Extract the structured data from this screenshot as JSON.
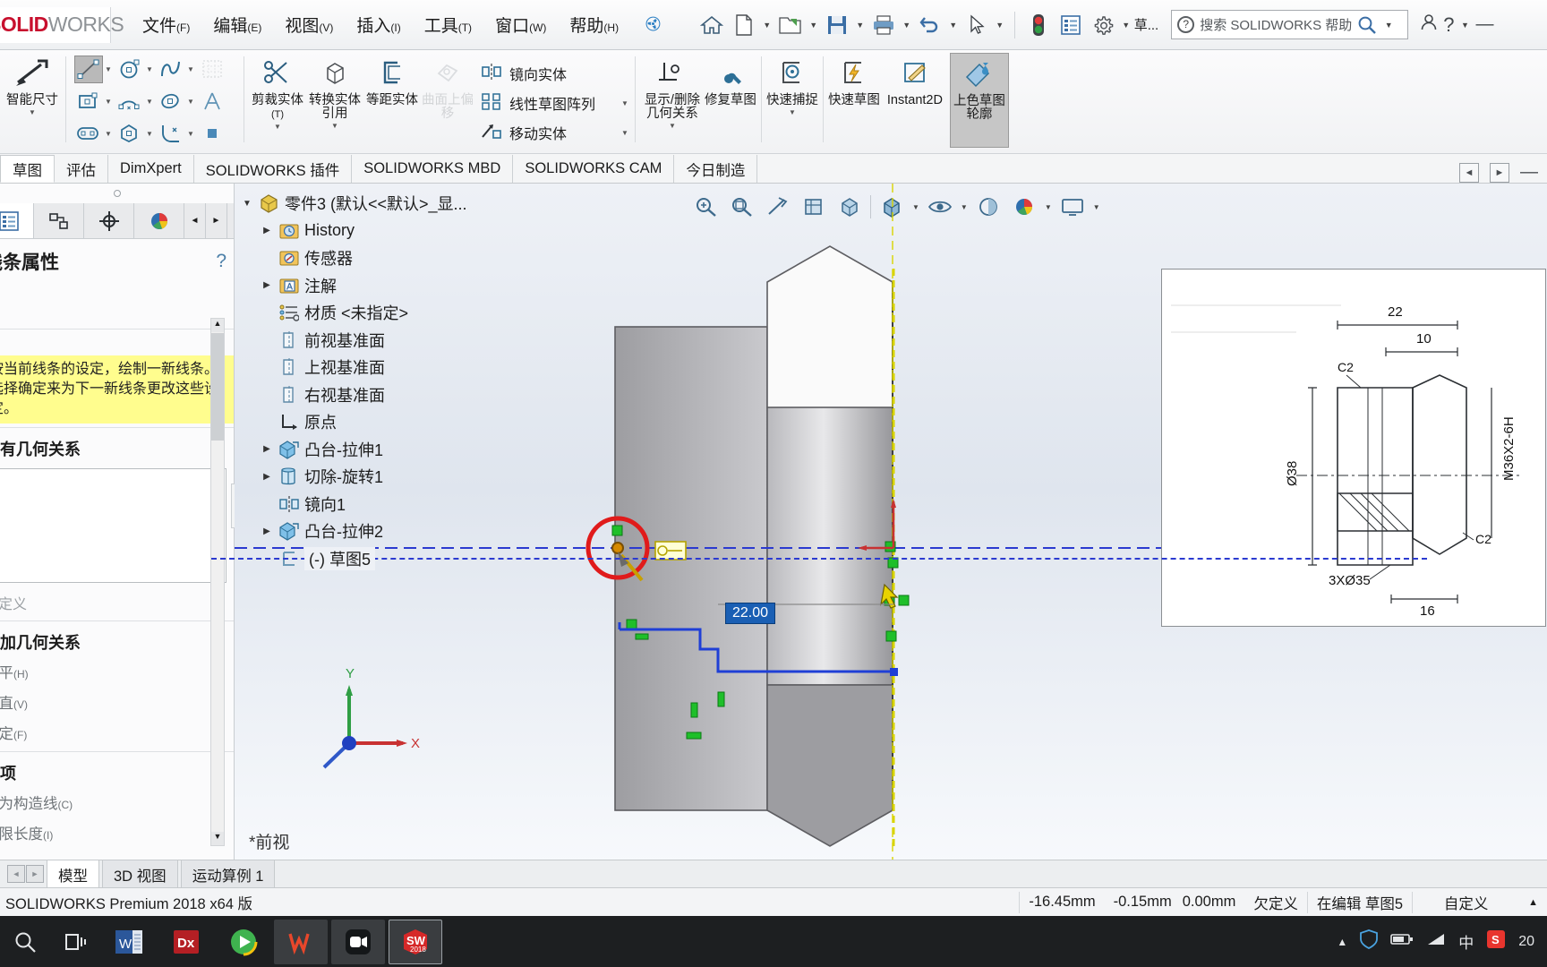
{
  "app": {
    "brand_solid": "SOLID",
    "brand_works": "WORKS",
    "version_text": "SOLIDWORKS Premium 2018 x64 版"
  },
  "menubar": {
    "items": [
      {
        "label": "文件",
        "accel": "(F)"
      },
      {
        "label": "编辑",
        "accel": "(E)"
      },
      {
        "label": "视图",
        "accel": "(V)"
      },
      {
        "label": "插入",
        "accel": "(I)"
      },
      {
        "label": "工具",
        "accel": "(T)"
      },
      {
        "label": "窗口",
        "accel": "(W)"
      },
      {
        "label": "帮助",
        "accel": "(H)"
      }
    ],
    "pin_icon": "pin-icon",
    "quick_tools": [
      {
        "name": "home-icon",
        "glyph": "⌂"
      },
      {
        "name": "new-document-icon",
        "glyph": "🗋"
      },
      {
        "name": "open-folder-icon",
        "glyph": "📂"
      },
      {
        "name": "save-icon",
        "glyph": "💾"
      },
      {
        "name": "print-icon",
        "glyph": "🖨"
      },
      {
        "name": "undo-icon",
        "glyph": "↶"
      },
      {
        "name": "select-arrow-icon",
        "glyph": "➤"
      },
      {
        "name": "rebuild-traffic-icon",
        "glyph": "🚦"
      },
      {
        "name": "options-list-icon",
        "glyph": "▤"
      },
      {
        "name": "settings-gear-icon",
        "glyph": "⚙"
      }
    ],
    "tab_label": "草...",
    "search_placeholder": "搜索 SOLIDWORKS 帮助",
    "right_icons": [
      {
        "name": "user-account-icon",
        "glyph": "👤"
      },
      {
        "name": "help-question-icon",
        "glyph": "?"
      },
      {
        "name": "minimize-icon",
        "glyph": "—"
      }
    ]
  },
  "ribbon": {
    "smart_dimension": {
      "label": "智能尺寸",
      "icon": "smart-dimension-icon"
    },
    "sketch_tools": [
      {
        "name": "line-tool",
        "glyph": "╱",
        "selected": true,
        "caret": true
      },
      {
        "name": "circle-tool",
        "glyph": "◎",
        "selected": false,
        "caret": true
      },
      {
        "name": "spline-tool",
        "glyph": "∿",
        "selected": false,
        "caret": true
      },
      {
        "name": "grid-tool",
        "glyph": "▦",
        "selected": false,
        "caret": false
      },
      {
        "name": "rectangle-tool",
        "glyph": "▭",
        "selected": false,
        "caret": true
      },
      {
        "name": "arc-tool",
        "glyph": "◠",
        "selected": false,
        "caret": true
      },
      {
        "name": "ellipse-tool",
        "glyph": "⬭",
        "selected": false,
        "caret": true
      },
      {
        "name": "text-tool",
        "glyph": "A",
        "selected": false,
        "caret": false
      },
      {
        "name": "slot-tool",
        "glyph": "▱",
        "selected": false,
        "caret": true
      },
      {
        "name": "polygon-tool",
        "glyph": "⬡",
        "selected": false,
        "caret": true
      },
      {
        "name": "fillet-tool",
        "glyph": "◜",
        "selected": false,
        "caret": true
      },
      {
        "name": "point-tool",
        "glyph": "▪",
        "selected": false,
        "caret": false
      }
    ],
    "big_buttons": [
      {
        "name": "trim-entities-button",
        "label": "剪裁实体",
        "accel": "(T)",
        "icon": "trim-icon",
        "caret": true,
        "disabled": false,
        "selected": false
      },
      {
        "name": "convert-entities-button",
        "label": "转换实体引用",
        "accel": "",
        "icon": "convert-entities-icon",
        "caret": true,
        "disabled": false,
        "selected": false
      },
      {
        "name": "offset-entities-button",
        "label": "等距实体",
        "accel": "",
        "icon": "offset-entities-icon",
        "caret": false,
        "disabled": false,
        "selected": false
      },
      {
        "name": "offset-on-surface-button",
        "label": "曲面上偏移",
        "accel": "",
        "icon": "offset-surface-icon",
        "caret": false,
        "disabled": true,
        "selected": false
      }
    ],
    "list_items": [
      {
        "name": "mirror-entities-item",
        "label": "镜向实体",
        "icon": "mirror-icon",
        "caret": false
      },
      {
        "name": "linear-sketch-pattern-item",
        "label": "线性草图阵列",
        "icon": "linear-pattern-icon",
        "caret": true
      },
      {
        "name": "move-entities-item",
        "label": "移动实体",
        "icon": "move-entities-icon",
        "caret": true
      }
    ],
    "big_buttons2": [
      {
        "name": "display-delete-relations-button",
        "label": "显示/删除几何关系",
        "accel": "",
        "icon": "relations-icon",
        "caret": true,
        "disabled": false,
        "selected": false
      },
      {
        "name": "repair-sketch-button",
        "label": "修复草图",
        "accel": "",
        "icon": "repair-sketch-icon",
        "caret": false,
        "disabled": false,
        "selected": false
      },
      {
        "name": "quick-snaps-button",
        "label": "快速捕捉",
        "accel": "",
        "icon": "quick-snaps-icon",
        "caret": true,
        "disabled": false,
        "selected": false
      },
      {
        "name": "rapid-sketch-button",
        "label": "快速草图",
        "accel": "",
        "icon": "rapid-sketch-icon",
        "caret": false,
        "disabled": false,
        "selected": false
      },
      {
        "name": "instant2d-button",
        "label": "Instant2D",
        "accel": "",
        "icon": "instant2d-icon",
        "caret": false,
        "disabled": false,
        "selected": false
      },
      {
        "name": "shaded-sketch-contours-button",
        "label": "上色草图轮廓",
        "accel": "",
        "icon": "shaded-contours-icon",
        "caret": false,
        "disabled": false,
        "selected": true
      }
    ]
  },
  "tabs": {
    "items": [
      {
        "label": "草图",
        "active": true
      },
      {
        "label": "评估",
        "active": false
      },
      {
        "label": "DimXpert",
        "active": false
      },
      {
        "label": "SOLIDWORKS 插件",
        "active": false
      },
      {
        "label": "SOLIDWORKS MBD",
        "active": false
      },
      {
        "label": "SOLIDWORKS CAM",
        "active": false
      },
      {
        "label": "今日制造",
        "active": false
      }
    ],
    "right_buttons": [
      {
        "name": "panel-collapse-left-button",
        "glyph": "◄"
      },
      {
        "name": "panel-collapse-right-button",
        "glyph": "►"
      },
      {
        "name": "window-minimize-button",
        "glyph": "—"
      }
    ]
  },
  "property_panel": {
    "tabs": [
      {
        "name": "feature-manager-tab",
        "glyph": "▤",
        "active": true
      },
      {
        "name": "property-manager-tab",
        "glyph": "⚵",
        "active": false
      },
      {
        "name": "configuration-manager-tab",
        "glyph": "⊕",
        "active": false
      },
      {
        "name": "display-manager-tab",
        "glyph": "◕",
        "active": false
      }
    ],
    "nav_prev": "◄",
    "nav_next": "►",
    "title": "线条属性",
    "help_icon": "help-circle-icon",
    "hint_text": "按当前线条的设定，绘制一新线条。选择确定来为下一新线条更改这些设定。",
    "existing_relations": {
      "title": "现有几何关系",
      "chevron": "⌃"
    },
    "underdefined_label": "欠定义",
    "add_relations": {
      "title": "添加几何关系",
      "chevron": "⌃",
      "items": [
        {
          "label": "水平",
          "accel": "(H)"
        },
        {
          "label": "竖直",
          "accel": "(V)"
        },
        {
          "label": "固定",
          "accel": "(F)"
        }
      ]
    },
    "options": {
      "title": "选项",
      "chevron": "⌃",
      "items": [
        {
          "label": "作为构造线",
          "accel": "(C)"
        },
        {
          "label": "无限长度",
          "accel": "(I)"
        }
      ]
    }
  },
  "tree": {
    "root": {
      "label": "零件3   (默认<<默认>_显...",
      "icon": "part-icon",
      "arrow": "▼"
    },
    "items": [
      {
        "label": "History",
        "icon": "history-icon",
        "arrow": "▶",
        "indent": 1
      },
      {
        "label": "传感器",
        "icon": "sensors-icon",
        "arrow": "",
        "indent": 1
      },
      {
        "label": "注解",
        "icon": "annotations-icon",
        "arrow": "▶",
        "indent": 1
      },
      {
        "label": "材质 <未指定>",
        "icon": "material-icon",
        "arrow": "",
        "indent": 1
      },
      {
        "label": "前视基准面",
        "icon": "plane-icon",
        "arrow": "",
        "indent": 1
      },
      {
        "label": "上视基准面",
        "icon": "plane-icon",
        "arrow": "",
        "indent": 1
      },
      {
        "label": "右视基准面",
        "icon": "plane-icon",
        "arrow": "",
        "indent": 1
      },
      {
        "label": "原点",
        "icon": "origin-icon",
        "arrow": "",
        "indent": 1
      },
      {
        "label": "凸台-拉伸1",
        "icon": "boss-extrude-icon",
        "arrow": "▶",
        "indent": 1
      },
      {
        "label": "切除-旋转1",
        "icon": "cut-revolve-icon",
        "arrow": "▶",
        "indent": 1
      },
      {
        "label": "镜向1",
        "icon": "mirror-feature-icon",
        "arrow": "",
        "indent": 1
      },
      {
        "label": "凸台-拉伸2",
        "icon": "boss-extrude-icon",
        "arrow": "▶",
        "indent": 1
      },
      {
        "label": "(-) 草图5",
        "icon": "sketch-icon",
        "arrow": "",
        "indent": 1,
        "editing": true
      }
    ]
  },
  "graphics": {
    "view_tools": [
      {
        "name": "zoom-to-fit-icon",
        "glyph": "⌕"
      },
      {
        "name": "zoom-to-area-icon",
        "glyph": "⌕"
      },
      {
        "name": "section-view-icon",
        "glyph": "✂"
      },
      {
        "name": "view-orientation-icon",
        "glyph": "▣"
      },
      {
        "name": "display-style-icon",
        "glyph": "◪"
      },
      {
        "name": "hide-show-items-icon",
        "glyph": "▥"
      },
      {
        "name": "view-cube-icon",
        "glyph": "⬛",
        "caret": true
      },
      {
        "name": "hide-show-eye-icon",
        "glyph": "👁",
        "caret": true
      },
      {
        "name": "apply-scene-icon",
        "glyph": "◐"
      },
      {
        "name": "appearance-sphere-icon",
        "glyph": "🎨",
        "caret": true
      },
      {
        "name": "view-settings-icon",
        "glyph": "🖵",
        "caret": true
      }
    ],
    "dimension_value": "22.00",
    "view_label": "*前视",
    "origin_x_label": "X",
    "origin_y_label": "Y"
  },
  "reference_drawing": {
    "dims": [
      "22",
      "10",
      "C2",
      "Ø38",
      "M36X2-6H",
      "3XØ35",
      "C2",
      "16"
    ]
  },
  "ime_bar": {
    "brand": "S",
    "mode": "中",
    "punct": "°,",
    "emoji_icon": "smiley-icon",
    "mic_icon": "microphone-icon",
    "keyboard_icon": "keyboard-icon"
  },
  "doc_tabs": {
    "nav_prev": "◄",
    "nav_next": "►",
    "items": [
      {
        "label": "模型",
        "active": true
      },
      {
        "label": "3D 视图",
        "active": false
      },
      {
        "label": "运动算例 1",
        "active": false
      }
    ]
  },
  "statusbar": {
    "version": "SOLIDWORKS Premium 2018 x64 版",
    "coord_x": "-16.45mm",
    "coord_y": "-0.15mm",
    "coord_z": "0.00mm",
    "state": "欠定义",
    "editing": "在编辑 草图5",
    "custom": "自定义",
    "caret": "▲"
  },
  "taskbar": {
    "search_icon": "search-icon",
    "taskview_icon": "task-view-icon",
    "apps": [
      {
        "name": "word-app",
        "label": "W",
        "color": "#2b579a",
        "active": false
      },
      {
        "name": "dx-app",
        "label": "Dx",
        "color": "#b41f24",
        "active": false
      },
      {
        "name": "media-player-app",
        "label": "▶",
        "color": "#3fb34f",
        "active": false
      },
      {
        "name": "wps-app",
        "label": "W",
        "color": "#e8472b",
        "active": true
      },
      {
        "name": "camera-recorder-app",
        "label": "◙",
        "color": "#1f2326",
        "active": true
      },
      {
        "name": "solidworks-app",
        "label": "SW",
        "color": "#d62828",
        "active": true,
        "year": "2018"
      }
    ],
    "tray": [
      {
        "name": "tray-caret-icon",
        "glyph": "▲"
      },
      {
        "name": "shield-icon",
        "glyph": "🛡"
      },
      {
        "name": "battery-icon",
        "glyph": "▭"
      },
      {
        "name": "wifi-icon",
        "glyph": "◣"
      },
      {
        "name": "ime-cn-icon",
        "glyph": "中"
      },
      {
        "name": "sogou-icon",
        "glyph": "S"
      }
    ],
    "clock": "20"
  }
}
